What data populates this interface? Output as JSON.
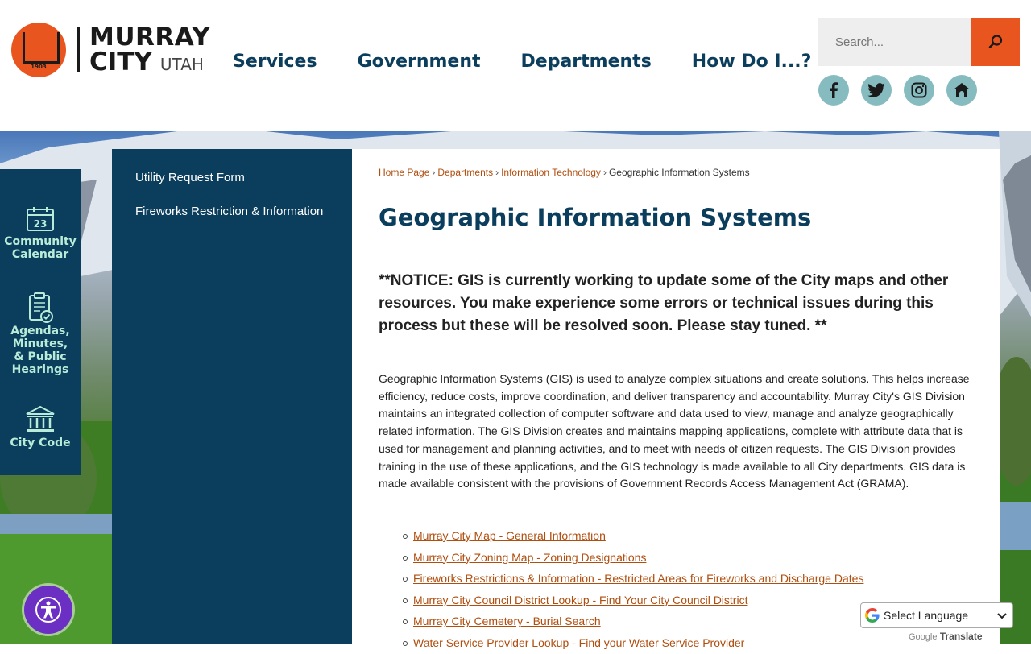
{
  "logo": {
    "line1": "MURRAY",
    "line2": "CITY",
    "state": "UTAH",
    "year": "1903"
  },
  "nav": {
    "services": "Services",
    "government": "Government",
    "departments": "Departments",
    "how_do_i": "How Do I...?"
  },
  "search": {
    "placeholder": "Search..."
  },
  "social": [
    "facebook-icon",
    "twitter-icon",
    "instagram-icon",
    "nextdoor-icon"
  ],
  "rail": {
    "calendar": {
      "day": "23",
      "line1": "Community",
      "line2": "Calendar"
    },
    "agendas": {
      "line1": "Agendas,",
      "line2": "Minutes,",
      "line3": "& Public",
      "line4": "Hearings"
    },
    "code": {
      "label": "City Code"
    }
  },
  "sidenav": {
    "items": [
      "Utility Request Form",
      "Fireworks Restriction & Information"
    ]
  },
  "breadcrumb": {
    "home": "Home Page",
    "departments": "Departments",
    "it": "Information Technology",
    "current": "Geographic Information Systems",
    "sep": "›"
  },
  "page": {
    "title": "Geographic Information Systems",
    "notice": "**NOTICE: GIS is currently working to update some of the City maps and other resources. You make experience some errors or technical issues during this process but these will be resolved soon. Please stay tuned. **",
    "body": "Geographic Information Systems (GIS) is used to analyze complex situations and create solutions. This helps increase efficiency, reduce costs, improve coordination, and deliver transparency and accountability. Murray City's GIS Division maintains an integrated collection of computer software and data used to view, manage and analyze geographically related information. The GIS Division creates and maintains mapping applications, complete with attribute data that is used for management and planning activities, and to meet with needs of citizen requests. The GIS Division provides training in the use of these applications, and the GIS technology is made available to all City departments. GIS data is made available consistent with the provisions of Government Records Access Management Act (GRAMA).",
    "links": [
      "Murray City Map - General Information",
      "Murray City Zoning Map - Zoning Designations",
      "Fireworks Restrictions & Information - Restricted Areas for Fireworks and Discharge Dates",
      "Murray City Council District Lookup - Find Your City Council District",
      "Murray City Cemetery - Burial Search",
      "Water Service Provider Lookup - Find your Water Service Provider"
    ]
  },
  "translate": {
    "label": "Select Language",
    "powered_brand": "Google",
    "powered_text": "Translate"
  },
  "colors": {
    "navy": "#0b3d5c",
    "orange": "#e8551e",
    "link": "#b04e0f",
    "mint": "#b8ecd9",
    "teal": "#86bcc0",
    "purple": "#6b2fc4"
  }
}
